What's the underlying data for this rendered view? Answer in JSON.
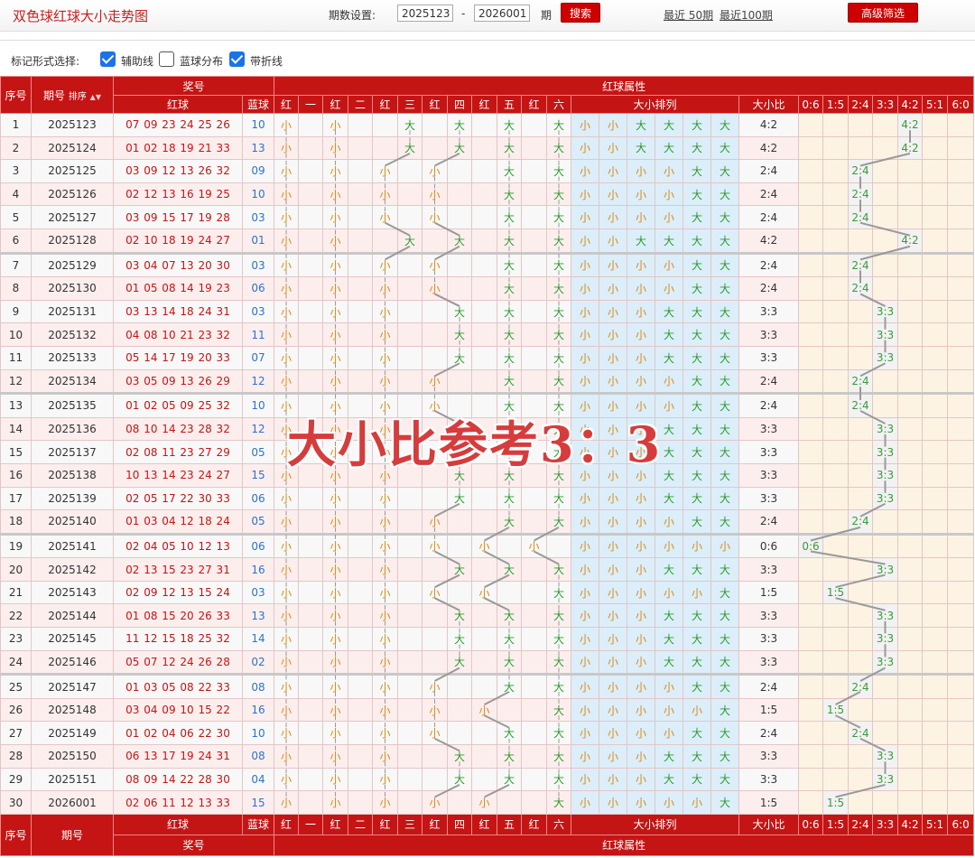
{
  "header": {
    "title": "双色球红球大小走势图",
    "period_label": "期数设置:",
    "from_value": "2025123",
    "dash": "-",
    "to_value": "2026001",
    "period_unit": "期",
    "search_label": "搜索",
    "recent50_label": "最近 50期",
    "recent100_label": "最近100期",
    "advanced_label": "高级筛选"
  },
  "options": {
    "label": "标记形式选择:",
    "items": [
      {
        "label": "辅助线",
        "checked": true
      },
      {
        "label": "蓝球分布",
        "checked": false
      },
      {
        "label": "带折线",
        "checked": true
      }
    ]
  },
  "table": {
    "head": {
      "seq": "序号",
      "issue": "期号",
      "sort": "排序",
      "prize": "奖号",
      "red": "红球",
      "blue": "蓝球",
      "red_attr": "红球属性",
      "positions": [
        "红",
        "一",
        "红",
        "二",
        "红",
        "三",
        "红",
        "四",
        "红",
        "五",
        "红",
        "六"
      ],
      "arrange": "大小排列",
      "ratio": "大小比",
      "dist": [
        "0:6",
        "1:5",
        "2:4",
        "3:3",
        "4:2",
        "5:1",
        "6:0"
      ]
    },
    "rows": [
      {
        "seq": "1",
        "issue": "2025123",
        "red": "07 09 23 24 25 26",
        "blue": "10"
      },
      {
        "seq": "2",
        "issue": "2025124",
        "red": "01 02 18 19 21 33",
        "blue": "13"
      },
      {
        "seq": "3",
        "issue": "2025125",
        "red": "03 09 12 13 26 32",
        "blue": "09"
      },
      {
        "seq": "4",
        "issue": "2025126",
        "red": "02 12 13 16 19 25",
        "blue": "10"
      },
      {
        "seq": "5",
        "issue": "2025127",
        "red": "03 09 15 17 19 28",
        "blue": "03"
      },
      {
        "seq": "6",
        "issue": "2025128",
        "red": "02 10 18 19 24 27",
        "blue": "01"
      },
      {
        "seq": "7",
        "issue": "2025129",
        "red": "03 04 07 13 20 30",
        "blue": "03"
      },
      {
        "seq": "8",
        "issue": "2025130",
        "red": "01 05 08 14 19 23",
        "blue": "06"
      },
      {
        "seq": "9",
        "issue": "2025131",
        "red": "03 13 14 18 24 31",
        "blue": "03"
      },
      {
        "seq": "10",
        "issue": "2025132",
        "red": "04 08 10 21 23 32",
        "blue": "11"
      },
      {
        "seq": "11",
        "issue": "2025133",
        "red": "05 14 17 19 20 33",
        "blue": "07"
      },
      {
        "seq": "12",
        "issue": "2025134",
        "red": "03 05 09 13 26 29",
        "blue": "12"
      },
      {
        "seq": "13",
        "issue": "2025135",
        "red": "01 02 05 09 25 32",
        "blue": "10"
      },
      {
        "seq": "14",
        "issue": "2025136",
        "red": "08 10 14 23 28 32",
        "blue": "12"
      },
      {
        "seq": "15",
        "issue": "2025137",
        "red": "02 08 11 23 27 29",
        "blue": "05"
      },
      {
        "seq": "16",
        "issue": "2025138",
        "red": "10 13 14 23 24 27",
        "blue": "15"
      },
      {
        "seq": "17",
        "issue": "2025139",
        "red": "02 05 17 22 30 33",
        "blue": "06"
      },
      {
        "seq": "18",
        "issue": "2025140",
        "red": "01 03 04 12 18 24",
        "blue": "05"
      },
      {
        "seq": "19",
        "issue": "2025141",
        "red": "02 04 05 10 12 13",
        "blue": "06"
      },
      {
        "seq": "20",
        "issue": "2025142",
        "red": "02 13 15 23 27 31",
        "blue": "16"
      },
      {
        "seq": "21",
        "issue": "2025143",
        "red": "02 09 12 13 15 24",
        "blue": "03"
      },
      {
        "seq": "22",
        "issue": "2025144",
        "red": "01 08 15 20 26 33",
        "blue": "13"
      },
      {
        "seq": "23",
        "issue": "2025145",
        "red": "11 12 15 18 25 32",
        "blue": "14"
      },
      {
        "seq": "24",
        "issue": "2025146",
        "red": "05 07 12 24 26 28",
        "blue": "02"
      },
      {
        "seq": "25",
        "issue": "2025147",
        "red": "01 03 05 08 22 33",
        "blue": "08"
      },
      {
        "seq": "26",
        "issue": "2025148",
        "red": "03 04 09 10 15 22",
        "blue": "16"
      },
      {
        "seq": "27",
        "issue": "2025149",
        "red": "01 02 04 06 22 30",
        "blue": "10"
      },
      {
        "seq": "28",
        "issue": "2025150",
        "red": "06 13 17 19 24 31",
        "blue": "08"
      },
      {
        "seq": "29",
        "issue": "2025151",
        "red": "08 09 14 22 28 30",
        "blue": "04"
      },
      {
        "seq": "30",
        "issue": "2026001",
        "red": "02 06 11 12 13 33",
        "blue": "15"
      }
    ],
    "small_label": "小",
    "big_label": "大",
    "big_threshold": 17,
    "foot": {
      "seq": "序号",
      "issue": "期号",
      "red": "红球",
      "blue": "蓝球",
      "prize": "奖号",
      "red_attr": "红球属性",
      "arrange": "大小排列",
      "ratio": "大小比"
    }
  },
  "overlay_text": "大小比参考3：3",
  "colors": {
    "header_red": "#c51414",
    "red_ball": "#c51414",
    "blue_ball": "#2f72c8",
    "small": "#d88b18",
    "big": "#2c9a2c",
    "arrange_bg": "#dceefa",
    "dist_bg": "#fdf3e3"
  }
}
